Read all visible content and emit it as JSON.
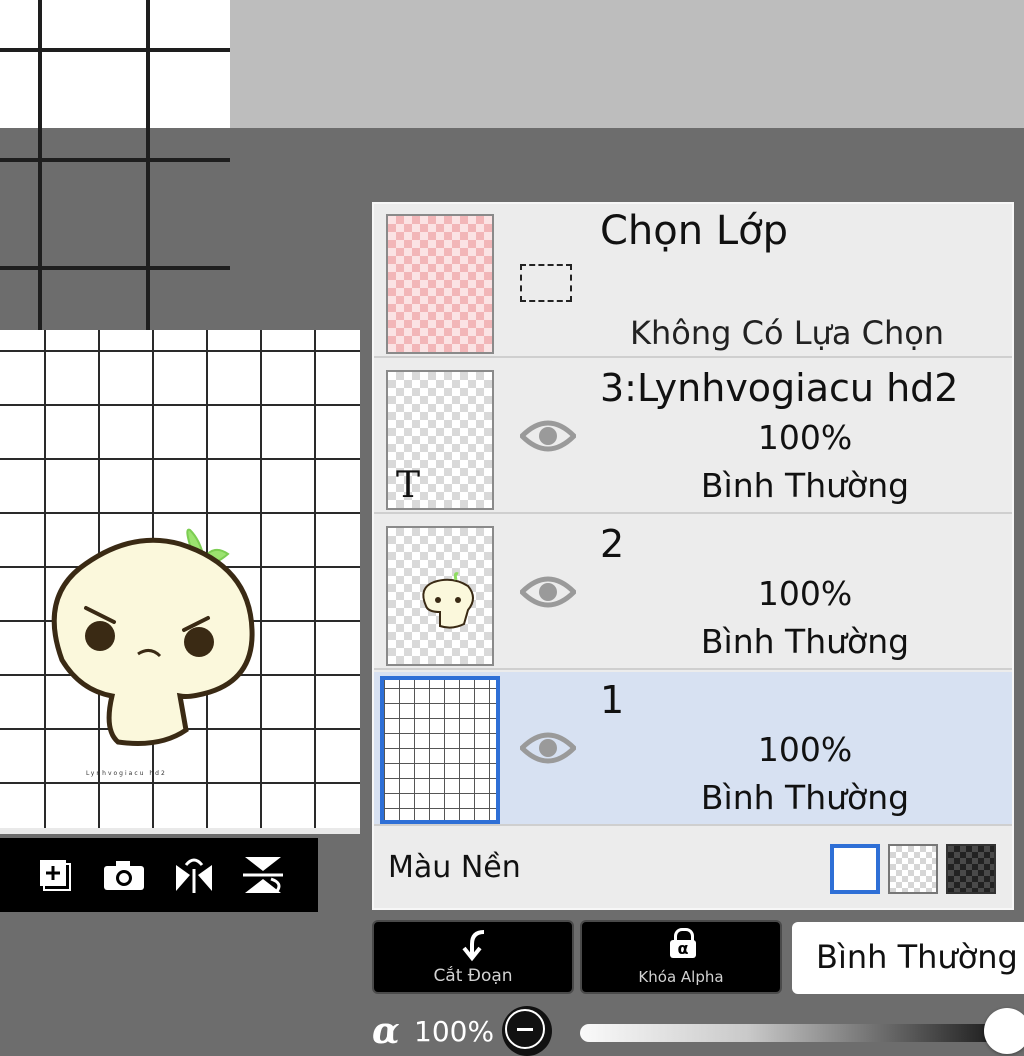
{
  "selection_layer": {
    "title": "Chọn Lớp",
    "status": "Không Có Lựa Chọn"
  },
  "layers": [
    {
      "name": "3:Lynhvogiacu hd2",
      "opacity": "100%",
      "blend": "Bình Thường",
      "thumb_glyph": "T",
      "visible": true,
      "selected": false
    },
    {
      "name": "2",
      "opacity": "100%",
      "blend": "Bình Thường",
      "visible": true,
      "selected": false
    },
    {
      "name": "1",
      "opacity": "100%",
      "blend": "Bình Thường",
      "visible": true,
      "selected": true
    }
  ],
  "background_color": {
    "label": "Màu Nền",
    "options": [
      "white",
      "transparent",
      "dark-checker"
    ],
    "selected": "white"
  },
  "actions": {
    "clipping_label": "Cắt Đoạn",
    "alpha_lock_label": "Khóa Alpha",
    "alpha_lock_glyph": "α",
    "blend_mode": "Bình Thường"
  },
  "alpha": {
    "symbol": "α",
    "value": "100%",
    "fraction": 1.0
  },
  "canvas": {
    "watermark": "Lynhvogiacu hd2"
  },
  "colors": {
    "accent": "#2e6fd6",
    "selected_row": "#d7e1f2",
    "panel": "#ececec",
    "workspace": "#6d6d6d"
  }
}
